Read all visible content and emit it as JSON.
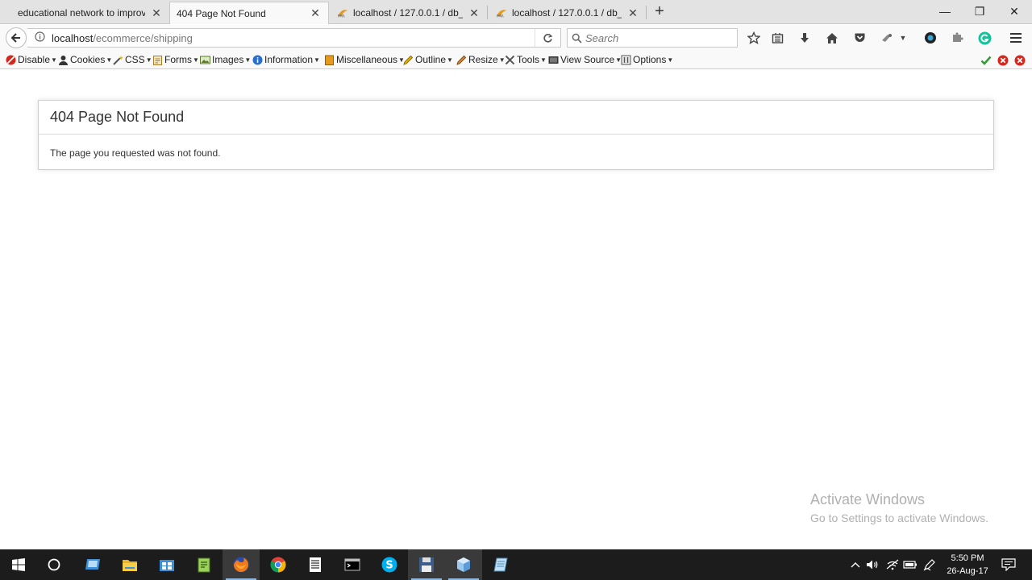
{
  "tabs": [
    {
      "title": "educational network to improve",
      "active": false
    },
    {
      "title": "404 Page Not Found",
      "active": true
    },
    {
      "title": "localhost / 127.0.0.1 / db_ci_",
      "active": false
    },
    {
      "title": "localhost / 127.0.0.1 / db_ci_",
      "active": false
    }
  ],
  "window_controls": {
    "minimize": "—",
    "maximize": "❐",
    "close": "✕"
  },
  "address": {
    "host": "localhost",
    "path": "/ecommerce/shipping"
  },
  "search": {
    "placeholder": "Search"
  },
  "devtoolbar": {
    "items": [
      "Disable",
      "Cookies",
      "CSS",
      "Forms",
      "Images",
      "Information",
      "Miscellaneous",
      "Outline",
      "Resize",
      "Tools",
      "View Source",
      "Options"
    ]
  },
  "page": {
    "heading": "404 Page Not Found",
    "message": "The page you requested was not found."
  },
  "watermark": {
    "line1": "Activate Windows",
    "line2": "Go to Settings to activate Windows."
  },
  "clock": {
    "time": "5:50 PM",
    "date": "26-Aug-17"
  },
  "colors": {
    "accent": "#0078d7",
    "error": "#d9261c",
    "ok": "#2e9e2e"
  }
}
